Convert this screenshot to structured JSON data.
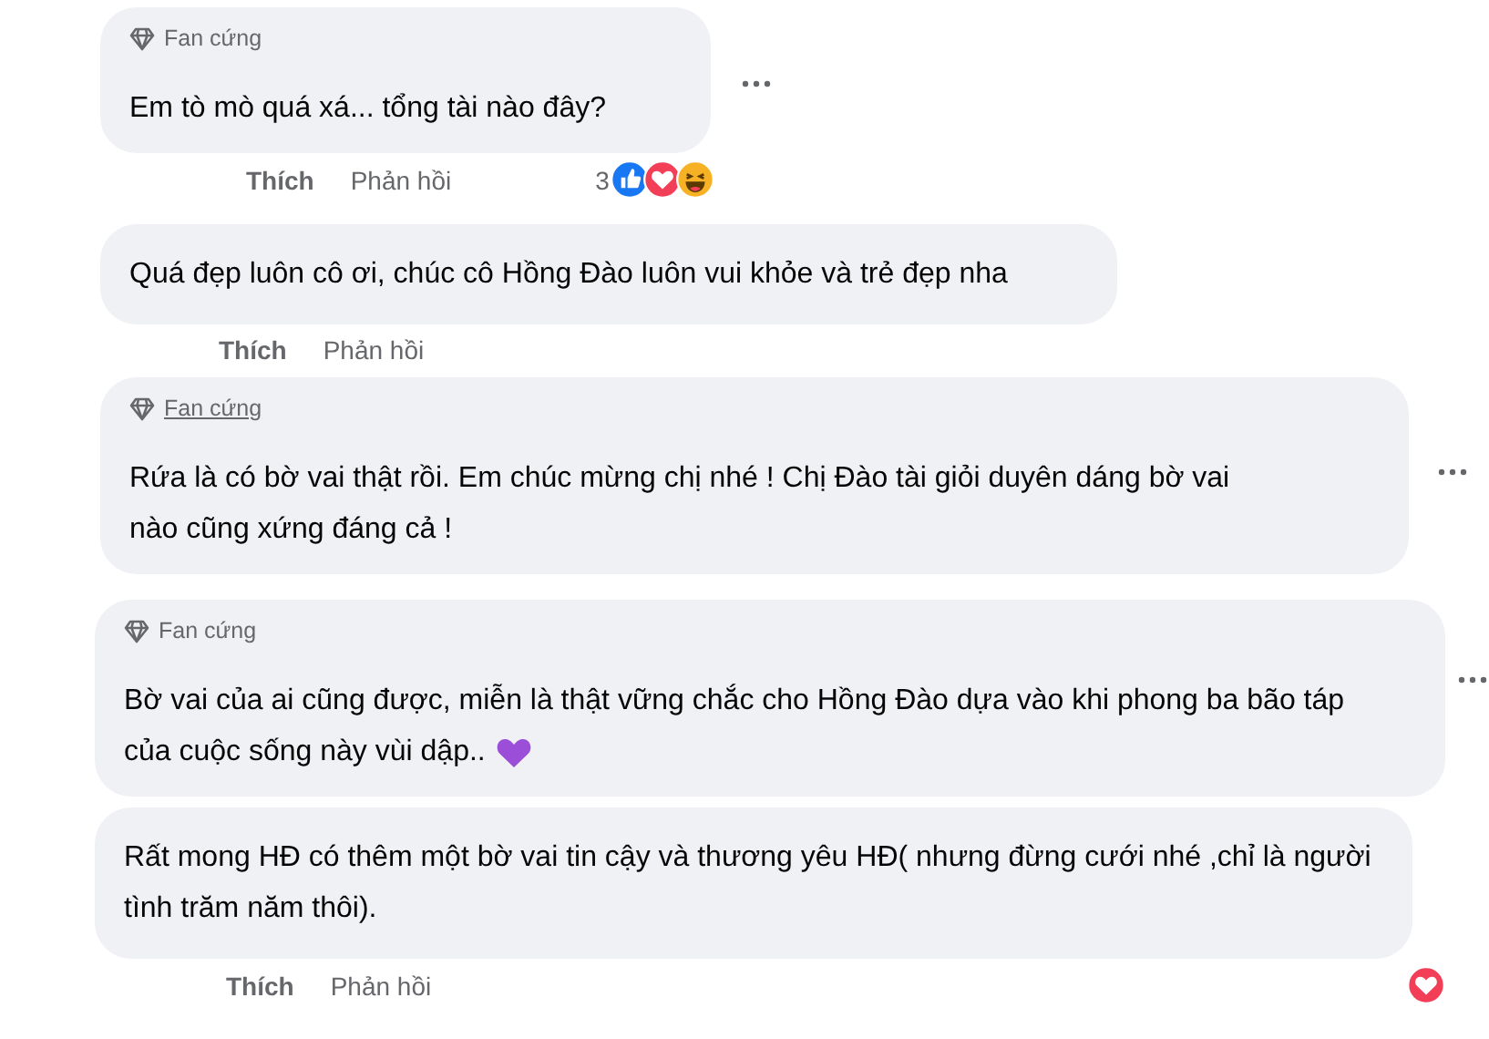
{
  "comments": [
    {
      "badge": {
        "label": "Fan cứng",
        "underlined": false
      },
      "text": "Em tò mò quá xá... tổng tài nào đây?",
      "actions": [
        "Thích",
        "Phản hồi"
      ],
      "reaction_count": "3",
      "reactions": [
        {
          "kind": "like"
        },
        {
          "kind": "love"
        },
        {
          "kind": "haha"
        }
      ],
      "more_menu": true
    },
    {
      "text": "Quá đẹp luôn cô ơi, chúc cô Hồng Đào luôn vui khỏe và trẻ đẹp nha",
      "actions": [
        "Thích",
        "Phản hồi"
      ]
    },
    {
      "badge": {
        "label": "Fan cứng",
        "underlined": true
      },
      "text": "Rứa là có bờ vai thật rồi. Em chúc mừng chị nhé ! Chị Đào tài giỏi duyên dáng bờ vai nào cũng xứng đáng cả !",
      "more_menu": true
    },
    {
      "badge": {
        "label": "Fan cứng",
        "underlined": false
      },
      "text": "Bờ vai của ai cũng được, miễn là thật vững chắc cho Hồng Đào dựa vào khi phong ba bão táp của cuộc sống này vùi dập..",
      "emoji": {
        "kind": "heart"
      },
      "more_menu": true
    },
    {
      "text": "Rất mong HĐ có thêm một bờ vai tin cậy và thương yêu HĐ( nhưng đừng cưới nhé ,chỉ là người tình trăm năm thôi).",
      "actions": [
        "Thích",
        "Phản hồi"
      ],
      "reactions": [
        {
          "kind": "love"
        }
      ]
    }
  ]
}
